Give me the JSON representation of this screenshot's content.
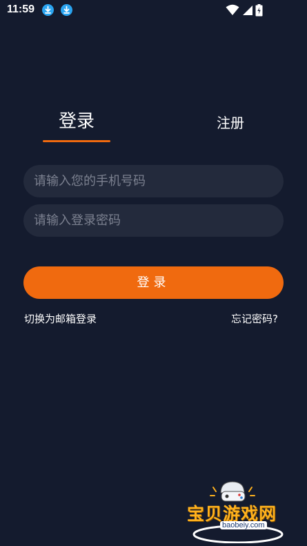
{
  "status_bar": {
    "time": "11:59",
    "icons": [
      "download-notification-icon",
      "download-notification-icon",
      "wifi-icon",
      "signal-icon",
      "battery-icon"
    ]
  },
  "tabs": {
    "login": "登录",
    "register": "注册"
  },
  "form": {
    "phone_placeholder": "请输入您的手机号码",
    "password_placeholder": "请输入登录密码",
    "submit_label": "登录"
  },
  "links": {
    "switch_email": "切换为邮箱登录",
    "forgot_password": "忘记密码?"
  },
  "watermark": {
    "title": "宝贝游戏网",
    "url": "baobeiy.com"
  },
  "colors": {
    "background": "#141b2e",
    "accent": "#f06a0f",
    "input_background": "#232a3c",
    "placeholder": "#7c8190"
  }
}
